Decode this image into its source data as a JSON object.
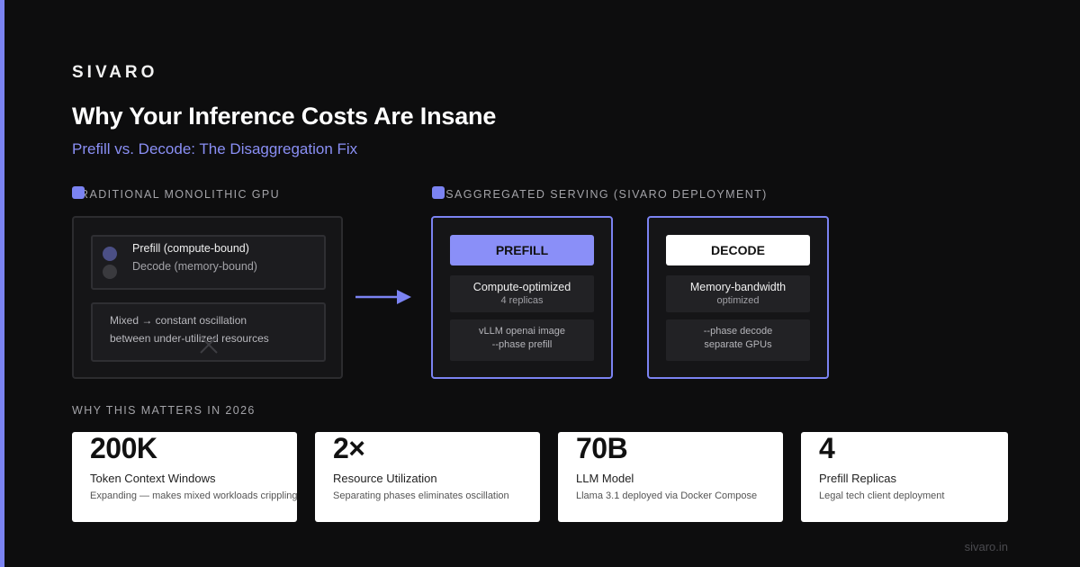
{
  "brand": "SIVARO",
  "title": "Why Your Inference Costs Are Insane",
  "subtitle": "Prefill vs. Decode: The Disaggregation Fix",
  "colors": {
    "accent": "#7b83f2",
    "background": "#0d0d0e"
  },
  "traditional": {
    "label": "TRADITIONAL MONOLITHIC GPU",
    "legend": [
      "Prefill (compute-bound)",
      "Decode (memory-bound)"
    ],
    "mixed_lines": [
      "Mixed → constant oscillation",
      "between under-utilized resources"
    ],
    "icon": "x-icon"
  },
  "arrow_icon": "arrow-right-icon",
  "disaggregated": {
    "label": "DISAGGREGATED SERVING (SIVARO DEPLOYMENT)",
    "prefill": {
      "title": "PREFILL",
      "line1": "Compute-optimized",
      "line2": "4 replicas",
      "cmd1": "vLLM openai image",
      "cmd2": "--phase prefill"
    },
    "decode": {
      "title": "DECODE",
      "line1": "Memory-bandwidth",
      "line2": "optimized",
      "cmd1": "--phase decode",
      "cmd2": "separate GPUs"
    }
  },
  "why_label": "WHY THIS MATTERS IN 2026",
  "stats": [
    {
      "value": "200K",
      "label": "Token Context Windows",
      "desc": "Expanding — makes mixed workloads crippling"
    },
    {
      "value": "2×",
      "label": "Resource Utilization",
      "desc": "Separating phases eliminates oscillation"
    },
    {
      "value": "70B",
      "label": "LLM Model",
      "desc": "Llama 3.1 deployed via Docker Compose"
    },
    {
      "value": "4",
      "label": "Prefill Replicas",
      "desc": "Legal tech client deployment"
    }
  ],
  "footer": "sivaro.in"
}
